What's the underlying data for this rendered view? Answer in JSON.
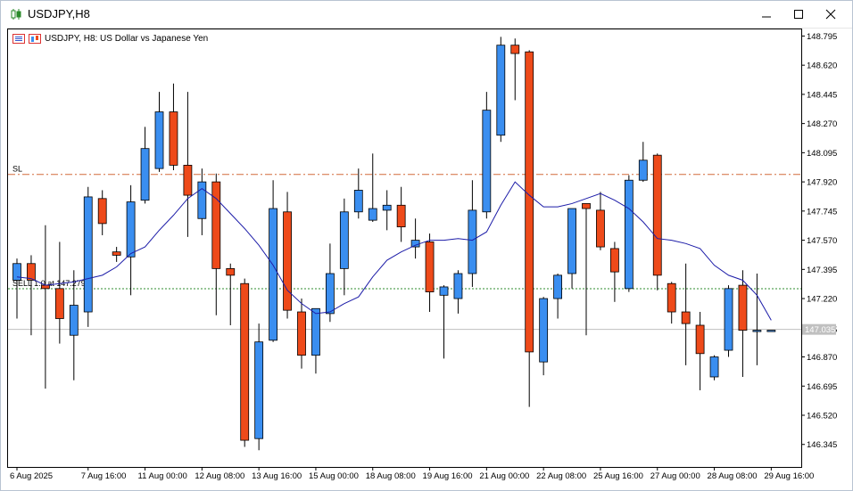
{
  "window": {
    "title": "USDJPY,H8",
    "controls": [
      "minimize-icon",
      "maximize-icon",
      "close-icon"
    ]
  },
  "chart_header": {
    "description": "USDJPY, H8:  US Dollar vs Japanese Yen"
  },
  "colors": {
    "bull": "#3a8ef0",
    "bear": "#ee4a1a",
    "ma": "#1c1ca8",
    "sl_line": "#d26a3a",
    "sell_line": "#2e8b2e",
    "bid_line": "#c0c0c0",
    "axis": "#000000",
    "price_tag_bg": "#c0c0c0"
  },
  "chart_data": {
    "type": "candlestick",
    "symbol": "USDJPY",
    "timeframe": "H8",
    "ylim": [
      146.21,
      148.84
    ],
    "y_ticks": [
      "148.795",
      "148.620",
      "148.445",
      "148.270",
      "148.095",
      "147.920",
      "147.745",
      "147.570",
      "147.395",
      "147.220",
      "147.035",
      "146.870",
      "146.695",
      "146.520",
      "146.345"
    ],
    "x_ticks": [
      {
        "label": "6 Aug 2025",
        "index": 0
      },
      {
        "label": "7 Aug 16:00",
        "index": 5
      },
      {
        "label": "11 Aug 00:00",
        "index": 9
      },
      {
        "label": "12 Aug 08:00",
        "index": 13
      },
      {
        "label": "13 Aug 16:00",
        "index": 17
      },
      {
        "label": "15 Aug 00:00",
        "index": 21
      },
      {
        "label": "18 Aug 08:00",
        "index": 25
      },
      {
        "label": "19 Aug 16:00",
        "index": 29
      },
      {
        "label": "21 Aug 00:00",
        "index": 33
      },
      {
        "label": "22 Aug 08:00",
        "index": 37
      },
      {
        "label": "25 Aug 16:00",
        "index": 41
      },
      {
        "label": "27 Aug 00:00",
        "index": 45
      },
      {
        "label": "28 Aug 08:00",
        "index": 49
      },
      {
        "label": "29 Aug 16:00",
        "index": 53
      }
    ],
    "candles": [
      {
        "o": 147.33,
        "h": 147.46,
        "l": 147.1,
        "c": 147.43
      },
      {
        "o": 147.43,
        "h": 147.48,
        "l": 147.0,
        "c": 147.33
      },
      {
        "o": 147.3,
        "h": 147.66,
        "l": 146.68,
        "c": 147.28
      },
      {
        "o": 147.28,
        "h": 147.56,
        "l": 146.95,
        "c": 147.1
      },
      {
        "o": 147.0,
        "h": 147.39,
        "l": 146.73,
        "c": 147.18
      },
      {
        "o": 147.14,
        "h": 147.89,
        "l": 147.05,
        "c": 147.83
      },
      {
        "o": 147.82,
        "h": 147.87,
        "l": 147.6,
        "c": 147.67
      },
      {
        "o": 147.5,
        "h": 147.53,
        "l": 147.44,
        "c": 147.48
      },
      {
        "o": 147.47,
        "h": 147.9,
        "l": 147.24,
        "c": 147.8
      },
      {
        "o": 147.81,
        "h": 148.25,
        "l": 147.79,
        "c": 148.12
      },
      {
        "o": 148.0,
        "h": 148.46,
        "l": 147.98,
        "c": 148.34
      },
      {
        "o": 148.34,
        "h": 148.51,
        "l": 147.99,
        "c": 148.02
      },
      {
        "o": 148.02,
        "h": 148.46,
        "l": 147.59,
        "c": 147.84
      },
      {
        "o": 147.7,
        "h": 148.0,
        "l": 147.6,
        "c": 147.92
      },
      {
        "o": 147.92,
        "h": 147.97,
        "l": 147.12,
        "c": 147.4
      },
      {
        "o": 147.4,
        "h": 147.43,
        "l": 147.06,
        "c": 147.36
      },
      {
        "o": 147.31,
        "h": 147.34,
        "l": 146.33,
        "c": 146.37
      },
      {
        "o": 146.38,
        "h": 147.07,
        "l": 146.31,
        "c": 146.96
      },
      {
        "o": 146.97,
        "h": 147.93,
        "l": 146.96,
        "c": 147.76
      },
      {
        "o": 147.74,
        "h": 147.86,
        "l": 147.1,
        "c": 147.15
      },
      {
        "o": 147.14,
        "h": 147.22,
        "l": 146.8,
        "c": 146.88
      },
      {
        "o": 146.88,
        "h": 147.16,
        "l": 146.77,
        "c": 147.16
      },
      {
        "o": 147.13,
        "h": 147.55,
        "l": 147.08,
        "c": 147.37
      },
      {
        "o": 147.4,
        "h": 147.82,
        "l": 147.24,
        "c": 147.74
      },
      {
        "o": 147.74,
        "h": 148.0,
        "l": 147.7,
        "c": 147.87
      },
      {
        "o": 147.69,
        "h": 148.09,
        "l": 147.68,
        "c": 147.76
      },
      {
        "o": 147.75,
        "h": 147.87,
        "l": 147.63,
        "c": 147.78
      },
      {
        "o": 147.78,
        "h": 147.89,
        "l": 147.56,
        "c": 147.65
      },
      {
        "o": 147.53,
        "h": 147.7,
        "l": 147.46,
        "c": 147.57
      },
      {
        "o": 147.56,
        "h": 147.61,
        "l": 147.14,
        "c": 147.26
      },
      {
        "o": 147.24,
        "h": 147.3,
        "l": 146.86,
        "c": 147.29
      },
      {
        "o": 147.22,
        "h": 147.39,
        "l": 147.13,
        "c": 147.37
      },
      {
        "o": 147.37,
        "h": 147.93,
        "l": 147.29,
        "c": 147.75
      },
      {
        "o": 147.74,
        "h": 148.46,
        "l": 147.7,
        "c": 148.35
      },
      {
        "o": 148.2,
        "h": 148.79,
        "l": 148.16,
        "c": 148.74
      },
      {
        "o": 148.74,
        "h": 148.78,
        "l": 148.41,
        "c": 148.69
      },
      {
        "o": 148.7,
        "h": 148.71,
        "l": 146.57,
        "c": 146.9
      },
      {
        "o": 146.84,
        "h": 147.23,
        "l": 146.76,
        "c": 147.22
      },
      {
        "o": 147.22,
        "h": 147.37,
        "l": 147.1,
        "c": 147.36
      },
      {
        "o": 147.37,
        "h": 147.75,
        "l": 147.28,
        "c": 147.76
      },
      {
        "o": 147.79,
        "h": 147.79,
        "l": 147.0,
        "c": 147.76
      },
      {
        "o": 147.75,
        "h": 147.86,
        "l": 147.51,
        "c": 147.53
      },
      {
        "o": 147.52,
        "h": 147.56,
        "l": 147.2,
        "c": 147.38
      },
      {
        "o": 147.28,
        "h": 147.96,
        "l": 147.26,
        "c": 147.93
      },
      {
        "o": 147.93,
        "h": 148.16,
        "l": 147.92,
        "c": 148.05
      },
      {
        "o": 148.08,
        "h": 148.09,
        "l": 147.27,
        "c": 147.36
      },
      {
        "o": 147.31,
        "h": 147.32,
        "l": 147.07,
        "c": 147.14
      },
      {
        "o": 147.14,
        "h": 147.43,
        "l": 146.82,
        "c": 147.07
      },
      {
        "o": 147.06,
        "h": 147.14,
        "l": 146.67,
        "c": 146.89
      },
      {
        "o": 146.75,
        "h": 146.88,
        "l": 146.73,
        "c": 146.87
      },
      {
        "o": 146.91,
        "h": 147.3,
        "l": 146.87,
        "c": 147.28
      },
      {
        "o": 147.3,
        "h": 147.39,
        "l": 146.75,
        "c": 147.03
      },
      {
        "o": 147.03,
        "h": 147.37,
        "l": 146.82,
        "c": 147.03
      },
      {
        "o": 147.03,
        "h": 147.03,
        "l": 147.03,
        "c": 147.03
      }
    ],
    "moving_average": [
      147.35,
      147.34,
      147.3,
      147.31,
      147.32,
      147.34,
      147.36,
      147.41,
      147.49,
      147.53,
      147.63,
      147.72,
      147.82,
      147.88,
      147.82,
      147.73,
      147.64,
      147.54,
      147.42,
      147.27,
      147.19,
      147.13,
      147.14,
      147.19,
      147.23,
      147.35,
      147.45,
      147.5,
      147.54,
      147.57,
      147.57,
      147.58,
      147.57,
      147.62,
      147.78,
      147.92,
      147.84,
      147.77,
      147.77,
      147.79,
      147.82,
      147.85,
      147.81,
      147.76,
      147.68,
      147.58,
      147.57,
      147.55,
      147.52,
      147.42,
      147.36,
      147.33,
      147.24,
      147.09
    ],
    "levels": [
      {
        "name": "SL",
        "label": "SL",
        "price": 147.965,
        "style": "dash-dot"
      },
      {
        "name": "sell",
        "label": "SELL 1.0 at 147.279",
        "price": 147.279,
        "style": "dotted"
      },
      {
        "name": "bid",
        "label": "",
        "price": 147.035,
        "style": "solid"
      }
    ],
    "current_price": "147.035"
  }
}
